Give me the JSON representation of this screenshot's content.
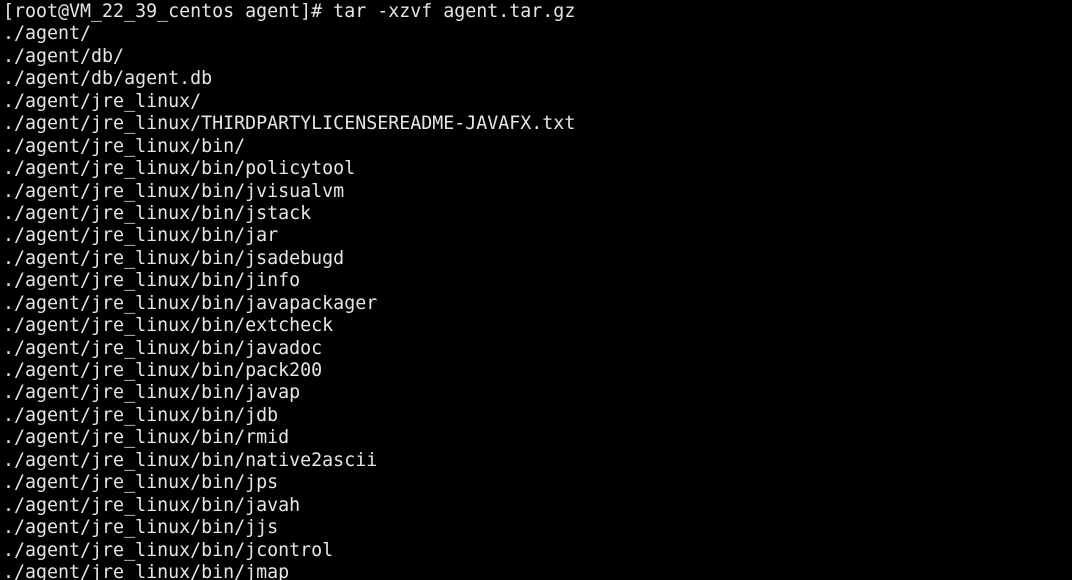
{
  "terminal": {
    "lines": [
      "[root@VM_22_39_centos agent]# tar -xzvf agent.tar.gz",
      "./agent/",
      "./agent/db/",
      "./agent/db/agent.db",
      "./agent/jre_linux/",
      "./agent/jre_linux/THIRDPARTYLICENSEREADME-JAVAFX.txt",
      "./agent/jre_linux/bin/",
      "./agent/jre_linux/bin/policytool",
      "./agent/jre_linux/bin/jvisualvm",
      "./agent/jre_linux/bin/jstack",
      "./agent/jre_linux/bin/jar",
      "./agent/jre_linux/bin/jsadebugd",
      "./agent/jre_linux/bin/jinfo",
      "./agent/jre_linux/bin/javapackager",
      "./agent/jre_linux/bin/extcheck",
      "./agent/jre_linux/bin/javadoc",
      "./agent/jre_linux/bin/pack200",
      "./agent/jre_linux/bin/javap",
      "./agent/jre_linux/bin/jdb",
      "./agent/jre_linux/bin/rmid",
      "./agent/jre_linux/bin/native2ascii",
      "./agent/jre_linux/bin/jps",
      "./agent/jre_linux/bin/javah",
      "./agent/jre_linux/bin/jjs",
      "./agent/jre_linux/bin/jcontrol",
      "./agent/jre_linux/bin/jmap"
    ]
  },
  "colors": {
    "background": "#000000",
    "foreground": "#e6e6e6"
  }
}
